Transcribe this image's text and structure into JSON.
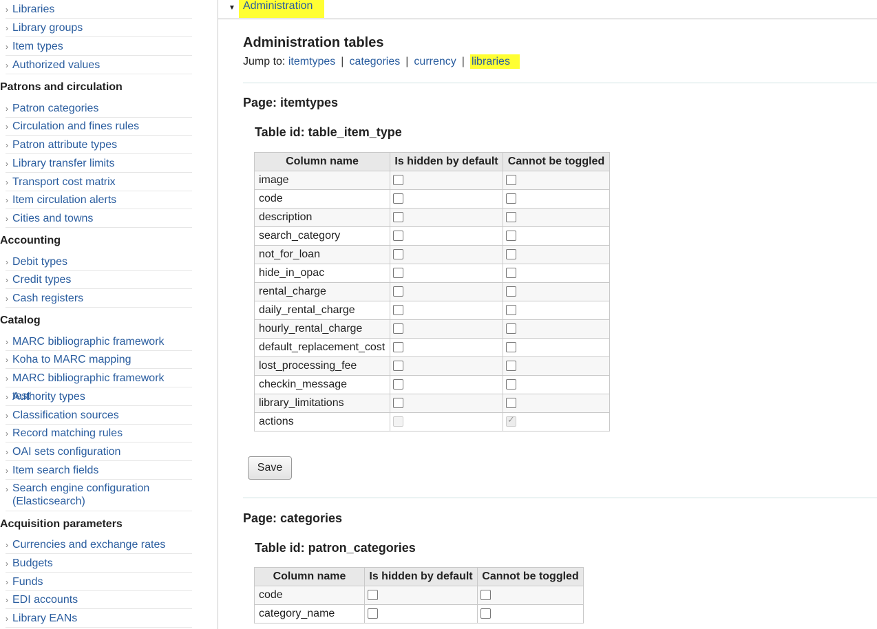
{
  "sidebar": {
    "group1": [
      "Libraries",
      "Library groups",
      "Item types",
      "Authorized values"
    ],
    "patrons": {
      "heading": "Patrons and circulation",
      "items": [
        "Patron categories",
        "Circulation and fines rules",
        "Patron attribute types",
        "Library transfer limits",
        "Transport cost matrix",
        "Item circulation alerts",
        "Cities and towns"
      ]
    },
    "accounting": {
      "heading": "Accounting",
      "items": [
        "Debit types",
        "Credit types",
        "Cash registers"
      ]
    },
    "catalog": {
      "heading": "Catalog",
      "items": [
        "MARC bibliographic framework",
        "Koha to MARC mapping",
        "MARC bibliographic framework test",
        "Authority types",
        "Classification sources",
        "Record matching rules",
        "OAI sets configuration",
        "Item search fields",
        "Search engine configuration (Elasticsearch)"
      ]
    },
    "acquisition": {
      "heading": "Acquisition parameters",
      "items": [
        "Currencies and exchange rates",
        "Budgets",
        "Funds",
        "EDI accounts",
        "Library EANs"
      ]
    }
  },
  "panel": {
    "title": "Administration"
  },
  "main": {
    "title": "Administration tables",
    "jump_label": "Jump to:",
    "jump_links": [
      "itemtypes",
      "categories",
      "currency",
      "libraries"
    ],
    "headers": {
      "column_name": "Column name",
      "hidden": "Is hidden by default",
      "cannot_toggle": "Cannot be toggled"
    },
    "save_label": "Save",
    "pages": [
      {
        "title": "Page: itemtypes",
        "table_id": "Table id: table_item_type",
        "rows": [
          "image",
          "code",
          "description",
          "search_category",
          "not_for_loan",
          "hide_in_opac",
          "rental_charge",
          "daily_rental_charge",
          "hourly_rental_charge",
          "default_replacement_cost",
          "lost_processing_fee",
          "checkin_message",
          "library_limitations",
          "actions"
        ]
      },
      {
        "title": "Page: categories",
        "table_id": "Table id: patron_categories",
        "rows": [
          "code",
          "category_name"
        ]
      }
    ]
  },
  "colors": {
    "link": "#2a5d9f",
    "highlight": "#ffff33"
  }
}
